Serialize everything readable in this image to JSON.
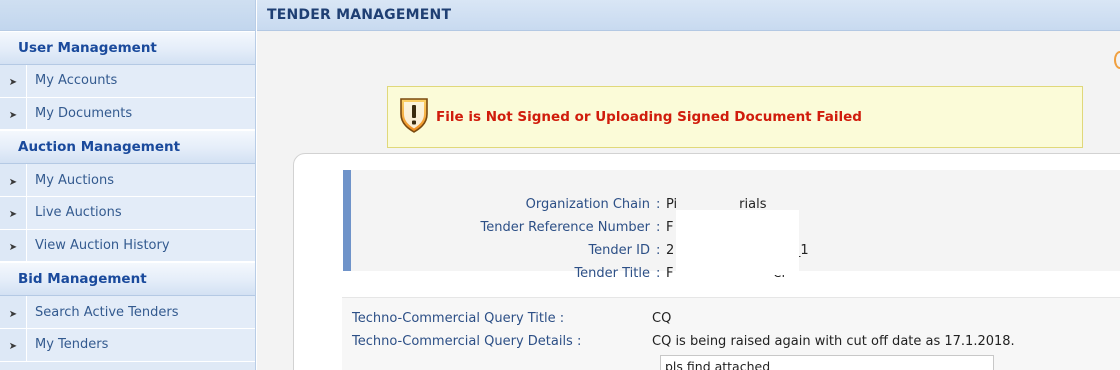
{
  "page": {
    "header_title": "TENDER MANAGEMENT"
  },
  "sidebar": {
    "sections": [
      {
        "title": "User Management",
        "items": [
          "My Accounts",
          "My Documents"
        ]
      },
      {
        "title": "Auction Management",
        "items": [
          "My Auctions",
          "Live Auctions",
          "View Auction History"
        ]
      },
      {
        "title": "Bid Management",
        "items": [
          "Search Active Tenders",
          "My Tenders"
        ]
      }
    ]
  },
  "alert": {
    "icon": "warning-shield-icon",
    "message": "File is Not Signed or Uploading Signed Document Failed",
    "color": "#d01c0c"
  },
  "tender_info": {
    "org_chain_label": "Organization Chain",
    "org_chain_value": "Pi",
    "org_chain_value_tail": "rials",
    "ref_label": "Tender Reference Number",
    "ref_value": "F",
    "id_label": "Tender ID",
    "id_value": "2",
    "id_value_tail": "33_1",
    "title_label": "Tender Title",
    "title_value": "F",
    "title_value_tail": "el"
  },
  "query": {
    "title_label": "Techno-Commercial Query Title :",
    "title_value": "CQ",
    "details_label": "Techno-Commercial Query Details :",
    "details_value": "CQ is being raised again with cut off date as 17.1.2018.",
    "response_value": "pls find attached"
  }
}
